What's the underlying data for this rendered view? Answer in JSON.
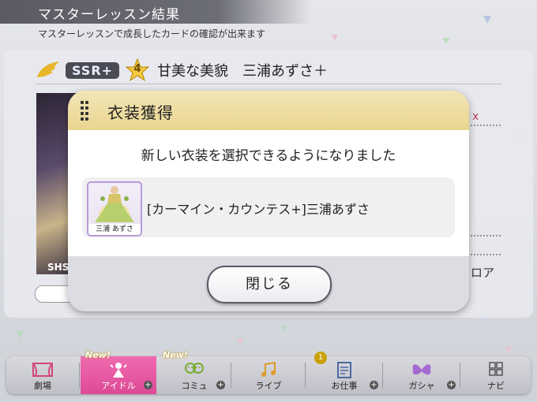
{
  "header": {
    "title": "マスターレッスン結果",
    "subtitle": "マスターレッスンで成長したカードの確認が出来ます"
  },
  "card": {
    "rarity": "SSR+",
    "level_star": "4",
    "name": "甘美な美貌　三浦あずさ＋",
    "art_text": "SHS",
    "right_text": "ロア",
    "right_mark": "x"
  },
  "modal": {
    "title": "衣装獲得",
    "message": "新しい衣装を選択できるようになりました",
    "item": {
      "thumb_label": "三浦 あずさ",
      "name": "[カーマイン・カウンテス+]三浦あずさ"
    },
    "close_label": "閉じる"
  },
  "nav": {
    "items": [
      {
        "label": "劇場",
        "new": "",
        "badge": "",
        "active": false
      },
      {
        "label": "アイドル",
        "new": "New!",
        "badge": "",
        "active": true
      },
      {
        "label": "コミュ",
        "new": "New!",
        "badge": "",
        "active": false
      },
      {
        "label": "ライブ",
        "new": "",
        "badge": "",
        "active": false
      },
      {
        "label": "お仕事",
        "new": "",
        "badge": "1",
        "active": false
      },
      {
        "label": "ガシャ",
        "new": "",
        "badge": "",
        "active": false
      },
      {
        "label": "ナビ",
        "new": "",
        "badge": "",
        "active": false
      }
    ]
  },
  "colors": {
    "accent_pink": "#e0509a",
    "modal_header": "#ecd994",
    "badge_gold": "#c9a000"
  }
}
